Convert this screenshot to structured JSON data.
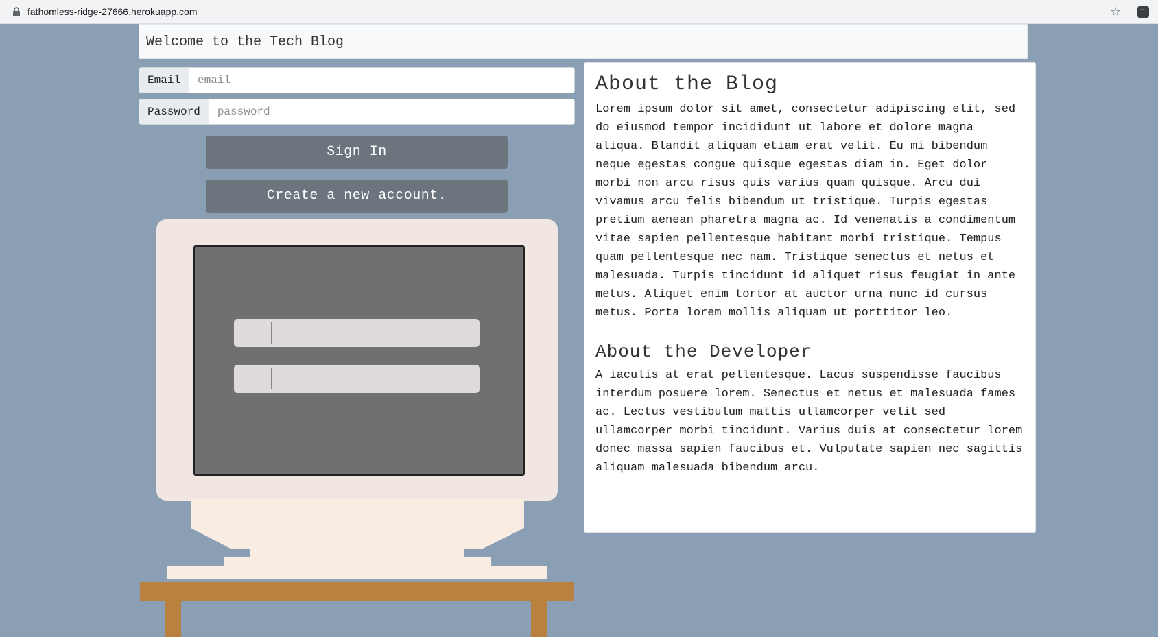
{
  "browser": {
    "url": "fathomless-ridge-27666.herokuapp.com",
    "lock_icon": "lock-icon",
    "star_icon": "star-icon",
    "extension_icon": "extension-icon"
  },
  "header": {
    "title": "Welcome to the Tech Blog"
  },
  "login": {
    "email_label": "Email",
    "email_placeholder": "email",
    "email_value": "",
    "password_label": "Password",
    "password_placeholder": "password",
    "password_value": "",
    "sign_in_label": "Sign In",
    "create_account_label": "Create a new account."
  },
  "about": {
    "blog_heading": "About the Blog",
    "blog_text": "Lorem ipsum dolor sit amet, consectetur adipiscing elit, sed do eiusmod tempor incididunt ut labore et dolore magna aliqua. Blandit aliquam etiam erat velit. Eu mi bibendum neque egestas congue quisque egestas diam in. Eget dolor morbi non arcu risus quis varius quam quisque. Arcu dui vivamus arcu felis bibendum ut tristique. Turpis egestas pretium aenean pharetra magna ac. Id venenatis a condimentum vitae sapien pellentesque habitant morbi tristique. Tempus quam pellentesque nec nam. Tristique senectus et netus et malesuada. Turpis tincidunt id aliquet risus feugiat in ante metus. Aliquet enim tortor at auctor urna nunc id cursus metus. Porta lorem mollis aliquam ut porttitor leo.",
    "dev_heading": "About the Developer",
    "dev_text": "A iaculis at erat pellentesque. Lacus suspendisse faucibus interdum posuere lorem. Senectus et netus et malesuada fames ac. Lectus vestibulum mattis ullamcorper velit sed ullamcorper morbi tincidunt. Varius duis at consectetur lorem donec massa sapien faucibus et. Vulputate sapien nec sagittis aliquam malesuada bibendum arcu."
  },
  "colors": {
    "background": "#8a9fb3",
    "button": "#6c757d",
    "monitor": "#f1e6e1",
    "screen": "#707070",
    "desk": "#b98040"
  }
}
